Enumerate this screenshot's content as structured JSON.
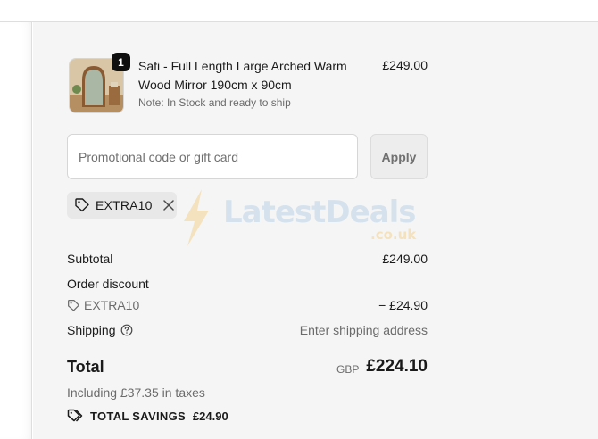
{
  "product": {
    "quantity": "1",
    "name": "Safi - Full Length Large Arched Warm Wood Mirror 190cm x 90cm",
    "note": "Note: In Stock and ready to ship",
    "price": "£249.00"
  },
  "promo": {
    "placeholder": "Promotional code or gift card",
    "apply_label": "Apply"
  },
  "applied_code": "EXTRA10",
  "watermark": {
    "word": "LatestDeals",
    "domain": ".co.uk"
  },
  "summary": {
    "subtotal_label": "Subtotal",
    "subtotal_value": "£249.00",
    "discount_label": "Order discount",
    "discount_code": "EXTRA10",
    "discount_value": "− £24.90",
    "shipping_label": "Shipping",
    "shipping_value": "Enter shipping address"
  },
  "total": {
    "label": "Total",
    "currency": "GBP",
    "amount": "£224.10",
    "taxes": "Including £37.35 in taxes",
    "savings_label": "TOTAL SAVINGS",
    "savings_value": "£24.90"
  },
  "icons": {
    "discount_tag": "tag-icon",
    "remove": "close-icon",
    "shipping_help": "question-circle-icon",
    "savings": "tags-icon",
    "watermark": "lightning-bolt-icon"
  },
  "colors": {
    "background": "#f5f5f5",
    "badge": "#0f0f0f",
    "chip": "#e8e8e8",
    "muted_text": "#6b6b6b"
  }
}
